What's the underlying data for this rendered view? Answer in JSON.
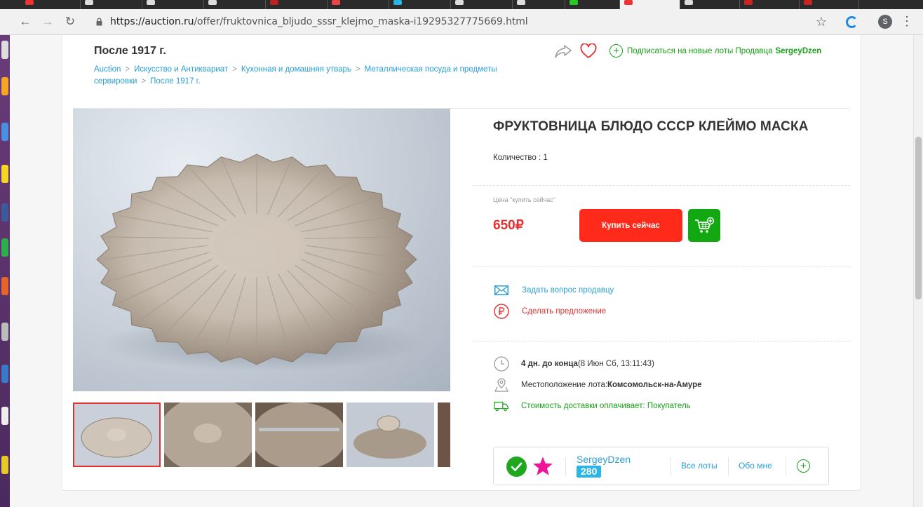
{
  "browser": {
    "url_domain": "https://auction.ru",
    "url_path": "/offer/fruktovnica_bljudo_sssr_klejmo_maska-i19295327775669.html",
    "profile_initial": "S"
  },
  "header": {
    "category_title": "После 1917 г.",
    "breadcrumbs": [
      "Auction",
      "Искусство и Антиквариат",
      "Кухонная и домашняя утварь",
      "Металлическая посуда и предметы сервировки",
      "После 1917 г."
    ],
    "separator": ">",
    "subscribe_text": "Подписаться на новые лоты Продавца",
    "seller_name": "SergeyDzen"
  },
  "lot": {
    "title": "ФРУКТОВНИЦА БЛЮДО СССР КЛЕЙМО МАСКА",
    "quantity": "Количество : 1",
    "price_label": "Цена \"купить сейчас\"",
    "price": "650₽",
    "buy_now": "Купить сейчас"
  },
  "actions": {
    "ask": "Задать вопрос продавцу",
    "offer": "Сделать предложение"
  },
  "info": {
    "deadline_bold": "4 дн. до конца",
    "deadline_rest": " (8 Июн Сб, 13:11:43)",
    "location_label": "Местоположение лота: ",
    "location_value": "Комсомольск-на-Амуре",
    "delivery": "Стоимость доставки оплачивает: Покупатель"
  },
  "seller": {
    "name": "SergeyDzen",
    "rating": "280",
    "all_lots": "Все лоты",
    "about": "Обо мне"
  },
  "colors": {
    "accent_blue": "#2a9fd6",
    "price_red": "#e53030",
    "buy_red": "#ff2a1a",
    "green": "#12a812",
    "star_magenta": "#f0129a"
  }
}
